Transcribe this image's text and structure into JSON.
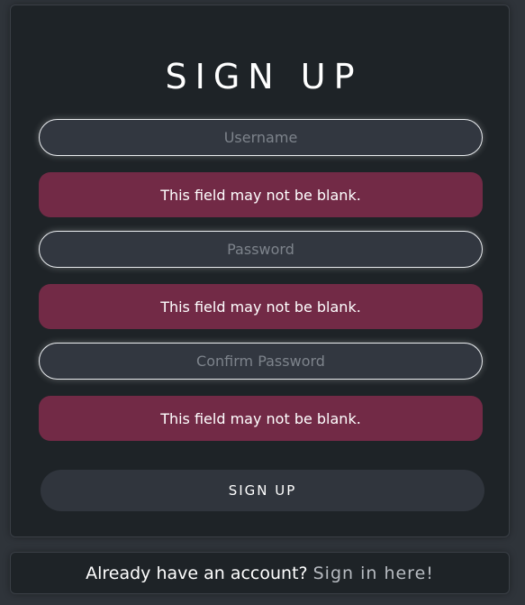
{
  "form": {
    "title": "SIGN UP",
    "username": {
      "placeholder": "Username",
      "value": "",
      "error": "This field may not be blank."
    },
    "password": {
      "placeholder": "Password",
      "value": "",
      "error": "This field may not be blank."
    },
    "confirm_password": {
      "placeholder": "Confirm Password",
      "value": "",
      "error": "This field may not be blank."
    },
    "submit_label": "SIGN UP"
  },
  "footer": {
    "prompt": "Already have an account?",
    "link_label": "Sign in here!"
  },
  "colors": {
    "background": "#2f343a",
    "card": "#1e2327",
    "input": "#323740",
    "error": "#722a46",
    "button": "#30353d",
    "link": "#b7bbc1"
  }
}
